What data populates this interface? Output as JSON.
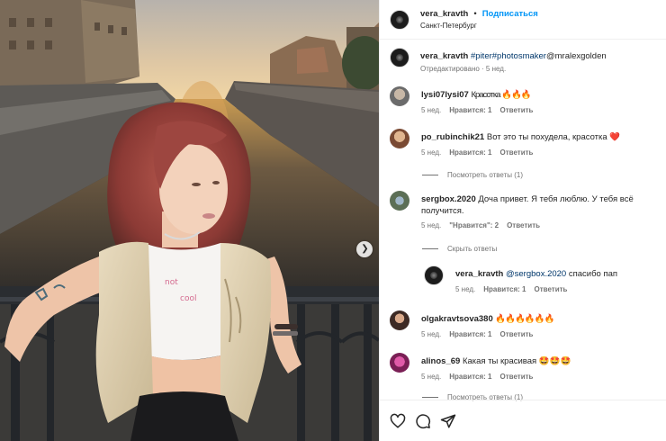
{
  "post": {
    "username": "vera_kravth",
    "follow_label": "Подписаться",
    "separator": "•",
    "location": "Санкт-Петербург"
  },
  "caption": {
    "username": "vera_kravth",
    "hashtags": "#piter#photosmaker",
    "mention": "@mralexgolden",
    "meta": "Отредактировано · 5 нед."
  },
  "comments": [
    {
      "username": "lysi07lysi07",
      "text": "Красотка 🔥🔥🔥",
      "time": "5 нед.",
      "likes": "Нравится: 1",
      "reply": "Ответить"
    },
    {
      "username": "po_rubinchik21",
      "text": "Вот это ты похудела, красотка ❤️",
      "time": "5 нед.",
      "likes": "Нравится: 1",
      "reply": "Ответить",
      "view_replies": "Посмотреть ответы (1)"
    },
    {
      "username": "sergbox.2020",
      "text_line1": "Доча привет. Я тебя люблю. У тебя всё",
      "text_line2": "получится.",
      "time": "5 нед.",
      "likes": "\"Нравится\": 2",
      "reply": "Ответить",
      "hide_replies": "Скрыть ответы"
    },
    {
      "username": "olgakravtsova380",
      "text": "🔥🔥🔥🔥🔥🔥",
      "time": "5 нед.",
      "likes": "Нравится: 1",
      "reply": "Ответить"
    },
    {
      "username": "alinos_69",
      "text": "Какая ты красивая 🤩🤩🤩",
      "time": "5 нед.",
      "likes": "Нравится: 1",
      "reply": "Ответить",
      "view_replies": "Посмотреть ответы (1)"
    }
  ],
  "reply": {
    "username": "vera_kravth",
    "mention": "@sergbox.2020",
    "text": "спасибо пап",
    "time": "5 нед.",
    "likes": "Нравится: 1",
    "reply": "Ответить"
  },
  "photo": {
    "shirt_text_line1": "not",
    "shirt_text_line2": "cool"
  },
  "icons": {
    "next": "chevron-right-icon",
    "like": "heart-outline-icon",
    "comment": "speech-bubble-icon",
    "share": "paper-plane-icon"
  },
  "colors": {
    "link": "#0095f6",
    "hashtag": "#00376b",
    "meta": "#737373",
    "text": "#262626"
  }
}
